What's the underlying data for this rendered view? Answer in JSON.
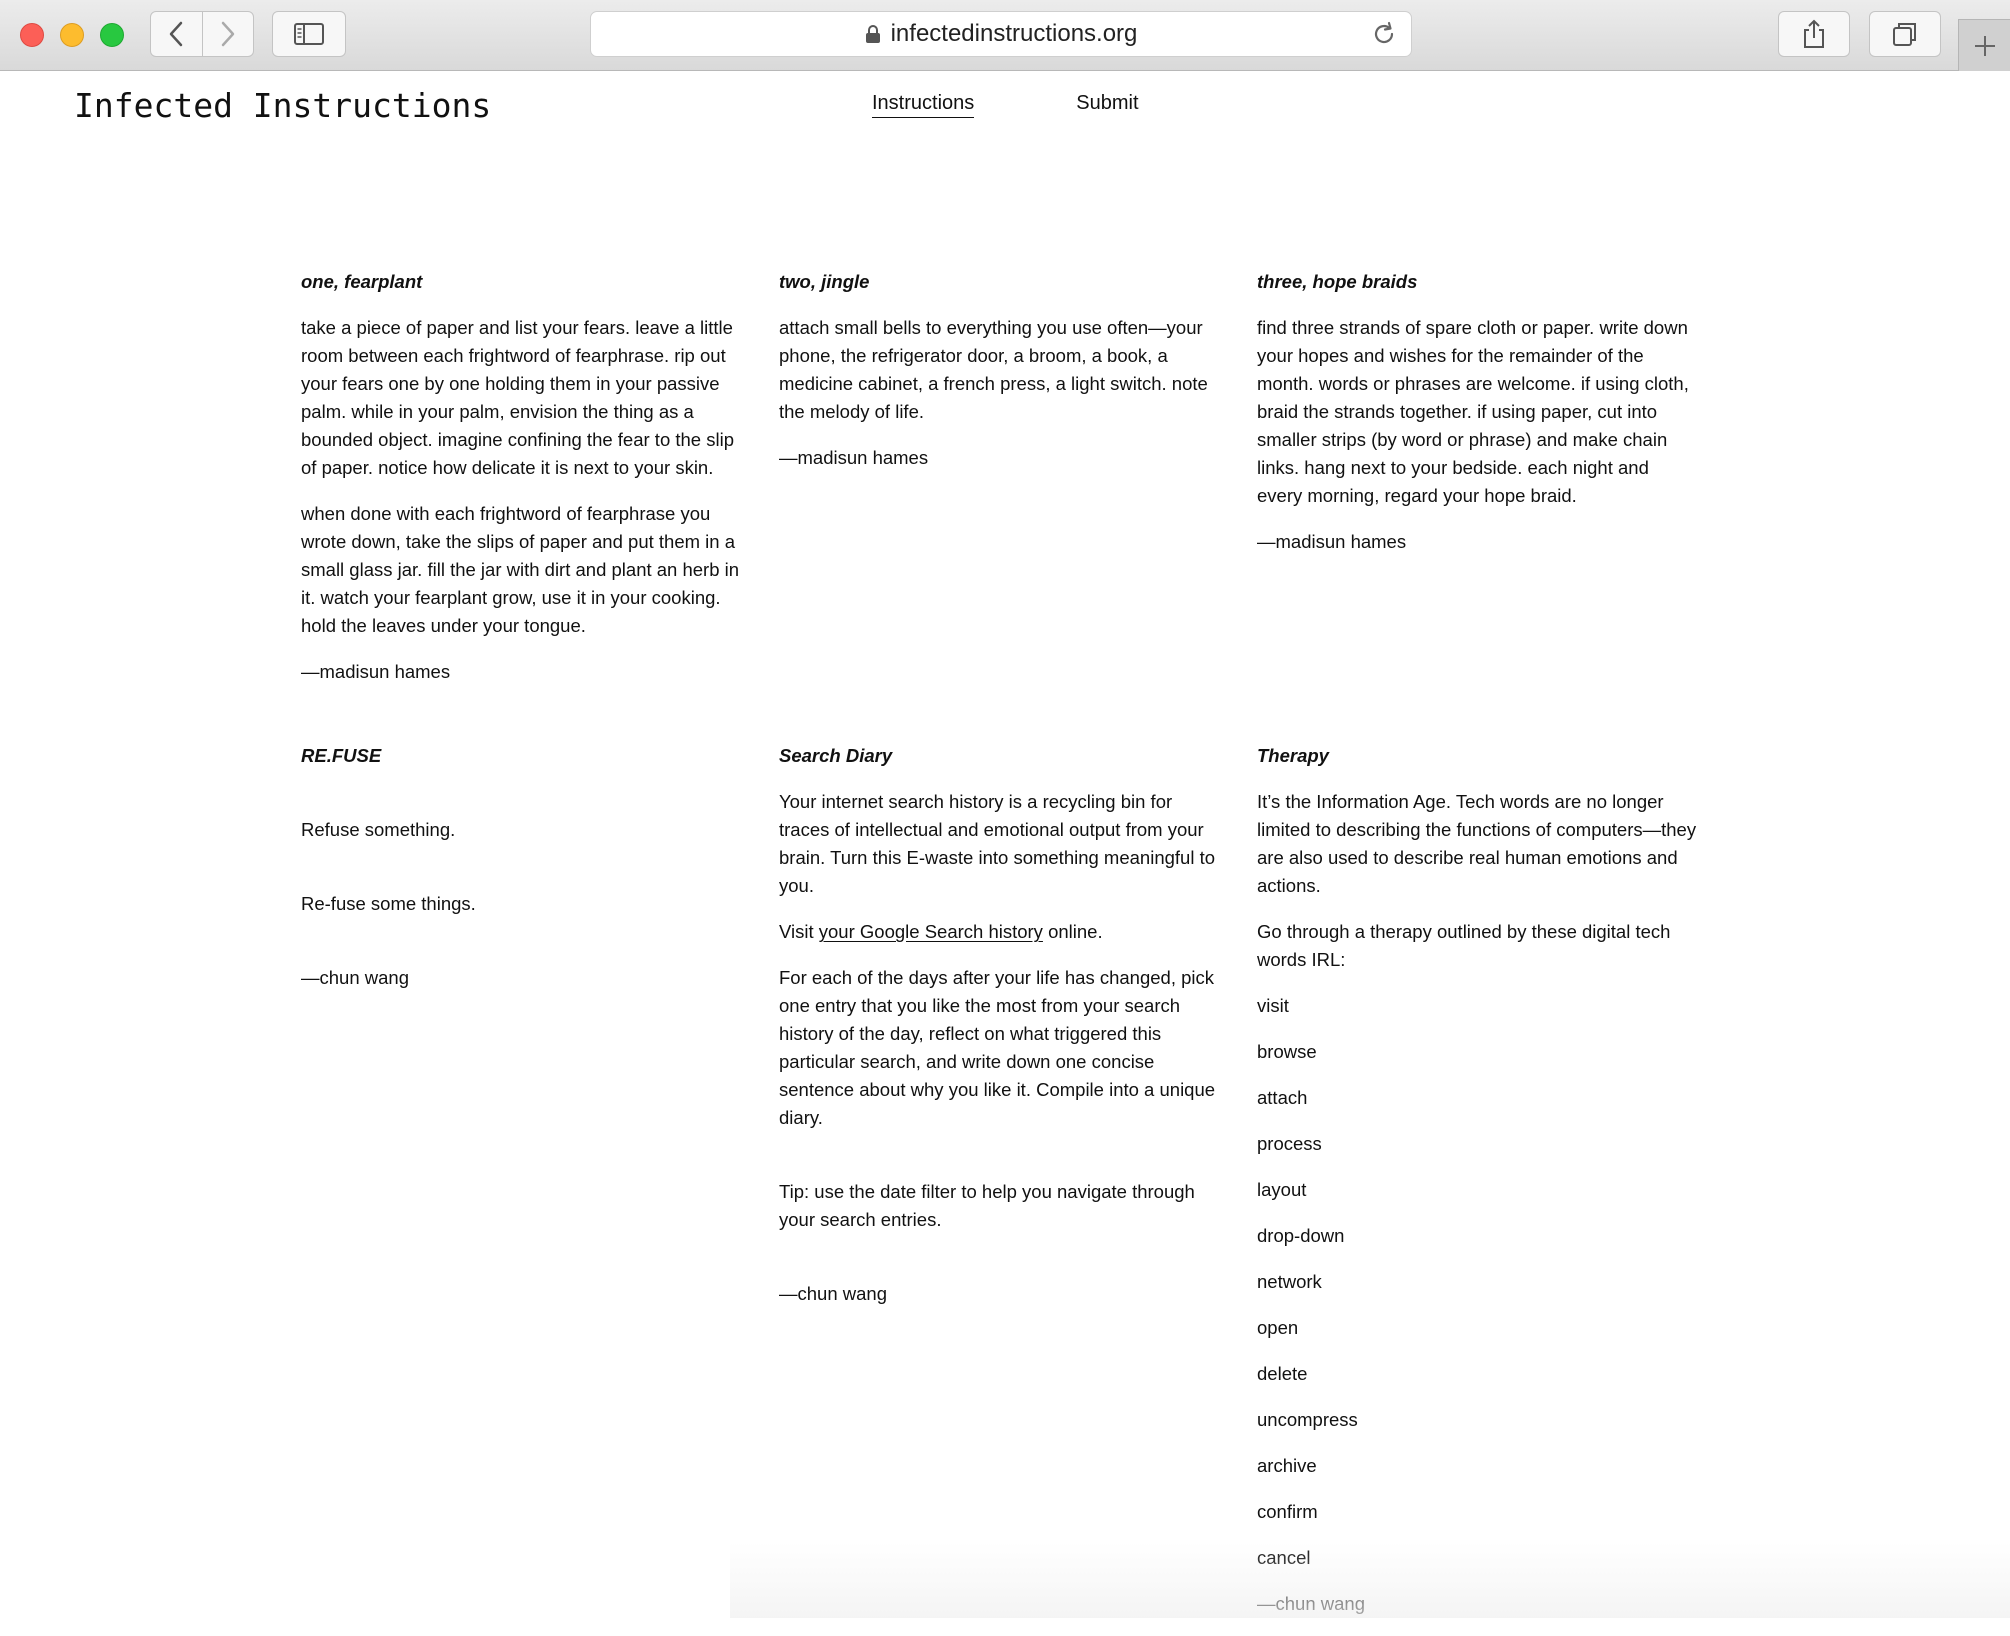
{
  "browser": {
    "url": "infectedinstructions.org",
    "icons": [
      "back-icon",
      "forward-icon",
      "sidebar-icon",
      "lock-icon",
      "reload-icon",
      "share-icon",
      "tabs-icon",
      "plus-icon"
    ]
  },
  "site": {
    "title": "Infected Instructions",
    "nav": {
      "instructions": "Instructions",
      "submit": "Submit"
    }
  },
  "cards": {
    "fearplant": {
      "title": "one, fearplant",
      "p1": "take a piece of paper and list your fears. leave a little room between each frightword of fearphrase. rip out your fears one by one holding them in your passive palm. while in your palm, envision the thing as a bounded object. imagine confining the fear to the slip of paper. notice how delicate it is next to your skin.",
      "p2": "when done with each frightword of fearphrase you wrote down, take the slips of paper and put them in a small glass jar. fill the jar with dirt and plant an herb in it. watch your fearplant grow, use it in your cooking. hold the leaves under your tongue.",
      "author": "—madisun hames"
    },
    "jingle": {
      "title": "two, jingle",
      "p1": "attach small bells to everything you use often—your phone, the refrigerator door, a broom, a book, a medicine cabinet, a french press, a light switch. note the melody of life.",
      "author": "—madisun hames"
    },
    "braids": {
      "title": "three, hope braids",
      "p1": "find three strands of spare cloth or paper. write down your hopes and wishes for the remainder of the month. words or phrases are welcome. if using cloth, braid the strands together. if using paper, cut into smaller strips (by word or phrase) and make chain links. hang next to your bedside. each night and every morning, regard your hope braid.",
      "author": "—madisun hames"
    },
    "refuse": {
      "title": "RE.FUSE",
      "p1": "Refuse something.",
      "p2": "Re-fuse some things.",
      "author": "—chun wang"
    },
    "diary": {
      "title": "Search Diary",
      "p1": "Your internet search history is a recycling bin for traces of intellectual and emotional output from your brain. Turn this E-waste into something meaningful to you.",
      "visit_pre": "Visit ",
      "visit_link": "your Google Search history",
      "visit_post": " online.",
      "p2": "For each of the days after your life has changed, pick one entry that you like the most from your search history of the day, reflect on what triggered this particular search, and write down one concise sentence about why you like it. Compile into a unique diary.",
      "tip": "Tip: use the date filter to help you navigate through your search entries.",
      "author": "—chun wang"
    },
    "therapy": {
      "title": "Therapy",
      "p1": "It’s the Information Age. Tech words are no longer limited to describing the functions of computers—they are also used to describe real human emotions and actions.",
      "p2": "Go through a therapy outlined by these digital tech words IRL:",
      "words": [
        "visit",
        "browse",
        "attach",
        "process",
        "layout",
        "drop-down",
        "network",
        "open",
        "delete",
        "uncompress",
        "archive",
        "confirm",
        "cancel"
      ],
      "author": "—chun wang"
    }
  }
}
